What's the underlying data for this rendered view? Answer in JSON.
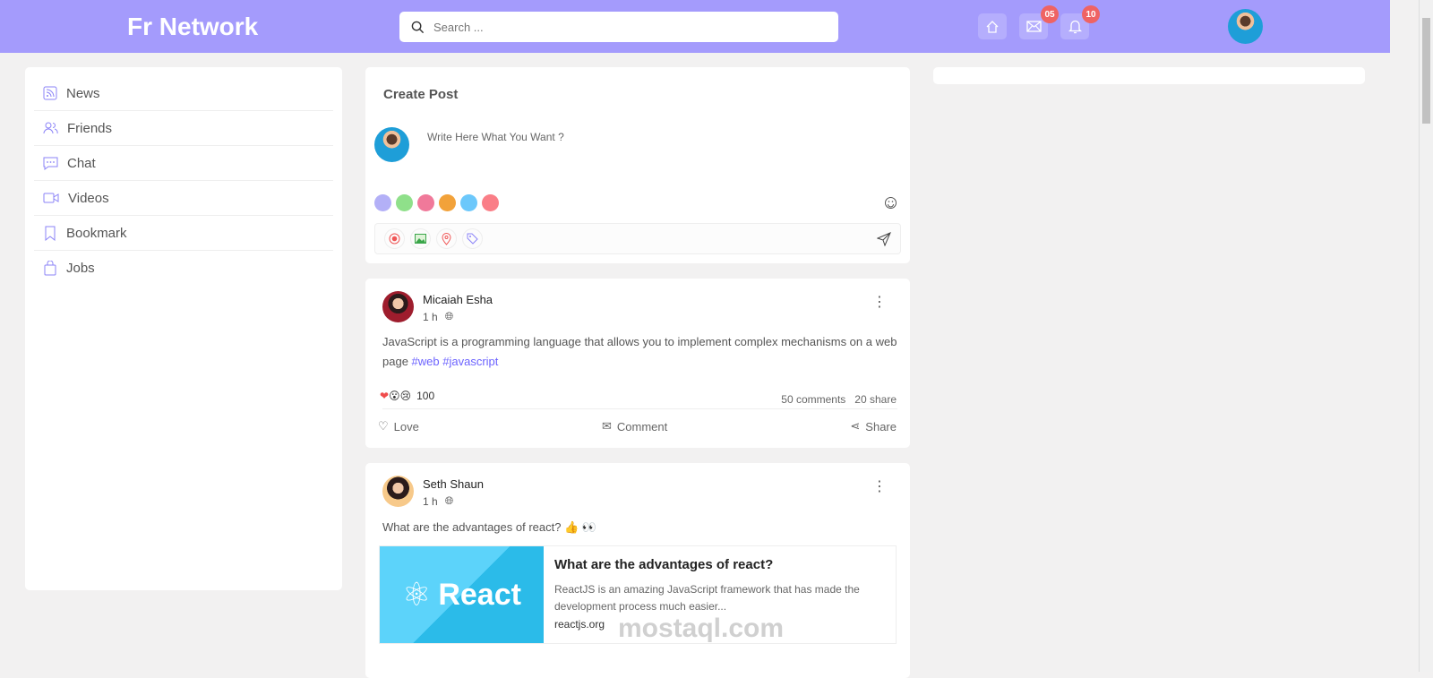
{
  "header": {
    "logo": "Fr Network",
    "search_placeholder": "Search ...",
    "messages_badge": "05",
    "notifications_badge": "10"
  },
  "sidebar": {
    "items": [
      {
        "label": "News"
      },
      {
        "label": "Friends"
      },
      {
        "label": "Chat"
      },
      {
        "label": "Videos"
      },
      {
        "label": "Bookmark"
      },
      {
        "label": "Jobs"
      }
    ]
  },
  "create_post": {
    "title": "Create Post",
    "placeholder": "Write Here What You Want ?",
    "swatch_colors": [
      "#b3b0f7",
      "#8fe08a",
      "#f0799a",
      "#f2a23a",
      "#6cc8fb",
      "#fa7e87"
    ]
  },
  "posts": [
    {
      "author": "Micaiah Esha",
      "time": "1 h",
      "text": "JavaScript is a programming language that allows you to implement complex mechanisms on a web page",
      "tags": [
        "#web",
        "#javascript"
      ],
      "reactions_count": "100",
      "comments": "50 comments",
      "shares": "20 share",
      "actions": {
        "love": "Love",
        "comment": "Comment",
        "share": "Share"
      }
    },
    {
      "author": "Seth Shaun",
      "time": "1 h",
      "text": "What are the advantages of react? 👍 👀",
      "link": {
        "image_text": "React",
        "title": "What are the advantages of react?",
        "desc": "ReactJS is an amazing JavaScript framework that has made the development process much easier...",
        "domain": "reactjs.org"
      }
    }
  ],
  "watermark": "mostaql.com"
}
